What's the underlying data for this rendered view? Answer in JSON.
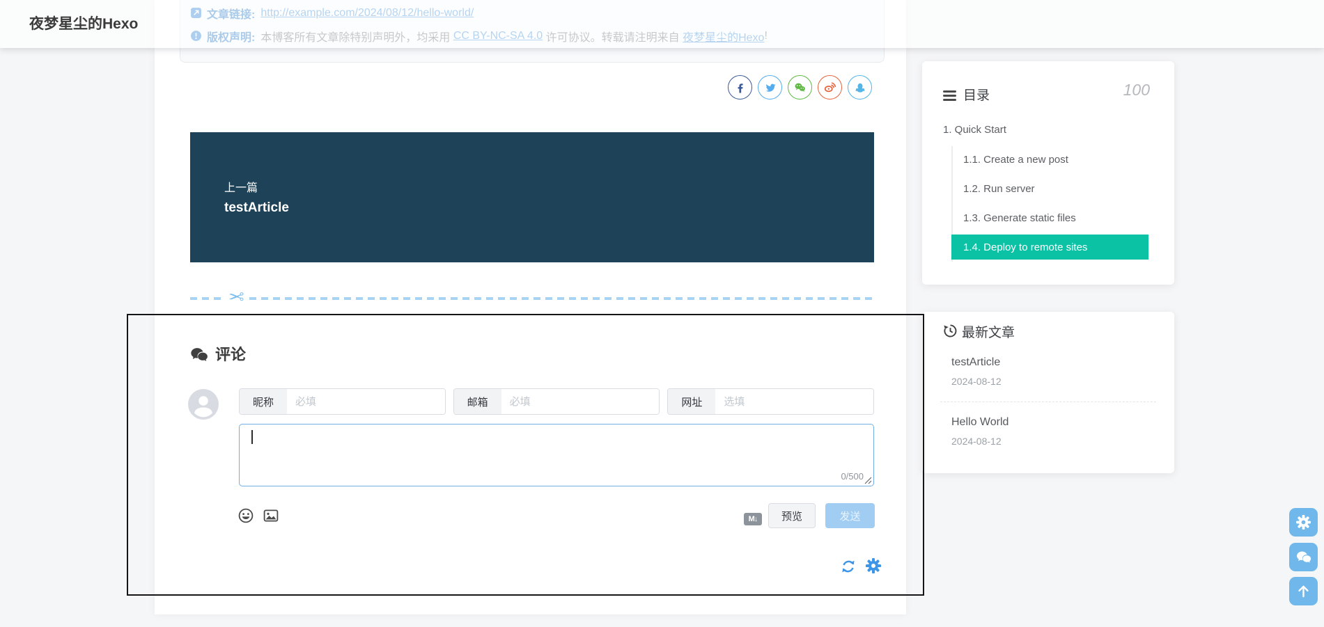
{
  "header": {
    "site_title": "夜梦星尘的Hexo"
  },
  "post_meta": {
    "link_label": "文章链接:",
    "link_url": "http://example.com/2024/08/12/hello-world/",
    "copyright_label": "版权声明:",
    "copyright_text_1": "本博客所有文章除特别声明外，均采用",
    "license_link": "CC BY-NC-SA 4.0",
    "copyright_text_2": "许可协议。转载请注明来自",
    "site_link": "夜梦星尘的Hexo",
    "copyright_text_3": "!"
  },
  "share": {
    "icons": [
      "facebook-icon",
      "twitter-icon",
      "wechat-icon",
      "weibo-icon",
      "qq-icon"
    ]
  },
  "prev_post": {
    "label": "上一篇",
    "title": "testArticle"
  },
  "comments": {
    "title": "评论",
    "fields": [
      {
        "label": "昵称",
        "placeholder": "必填"
      },
      {
        "label": "邮箱",
        "placeholder": "必填"
      },
      {
        "label": "网址",
        "placeholder": "选填"
      }
    ],
    "textarea_value": "",
    "char_count": "0/500",
    "markdown_badge": "M↓",
    "preview_label": "预览",
    "send_label": "发送"
  },
  "toc": {
    "title": "目录",
    "progress": "100",
    "items": [
      {
        "label": "1. Quick Start",
        "level": 1,
        "active": false
      },
      {
        "label": "1.1. Create a new post",
        "level": 2,
        "active": false
      },
      {
        "label": "1.2. Run server",
        "level": 2,
        "active": false
      },
      {
        "label": "1.3. Generate static files",
        "level": 2,
        "active": false
      },
      {
        "label": "1.4. Deploy to remote sites",
        "level": 2,
        "active": true
      }
    ]
  },
  "recent_posts": {
    "title": "最新文章",
    "items": [
      {
        "title": "testArticle",
        "date": "2024-08-12"
      },
      {
        "title": "Hello World",
        "date": "2024-08-12"
      }
    ]
  },
  "colors": {
    "accent_blue": "#3d95e8",
    "toc_active_bg": "#0bc2a5",
    "prev_card_bg": "#1e4258",
    "float_button_bg": "#70b7ec",
    "textarea_focus_border": "#70aee4"
  }
}
